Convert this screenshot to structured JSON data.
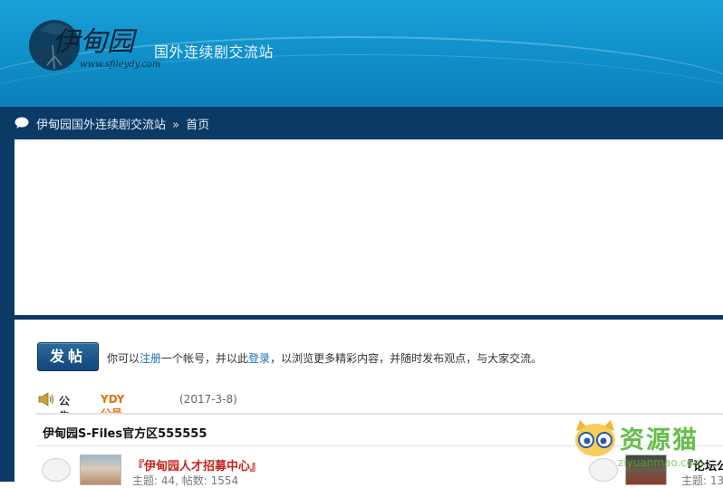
{
  "header": {
    "logo_text": "伊甸园",
    "logo_url": "www.sfileydy.com",
    "slogan": "国外连续剧交流站"
  },
  "breadcrumb": {
    "site": "伊甸园国外连续剧交流站",
    "separator": "»",
    "current": "首页"
  },
  "toolbar": {
    "post_label": "发帖"
  },
  "welcome": {
    "prefix": "你可以",
    "register_link": "注册",
    "middle": "一个帐号，并以此",
    "login_link": "登录",
    "suffix": "，以浏览更多精彩内容，并随时发布观点，与大家交流。"
  },
  "notice": {
    "label": "公告:",
    "title": "YDY公号扫码",
    "date": "(2017-3-8)"
  },
  "section": {
    "name": "伊甸园S-Files官方区555555"
  },
  "forums": [
    {
      "title": "『伊甸园人才招募中心』",
      "stats": "主题: 44, 帖数: 1554"
    },
    {
      "title": "『论坛公",
      "stats": "主题: 13"
    }
  ],
  "watermark": {
    "text": "资源猫",
    "url": "ziyuanmao.com"
  },
  "colors": {
    "header_blue": "#1aa0d8",
    "navy": "#0b3a66",
    "notice_orange": "#e0720a",
    "forum_red": "#c8231a",
    "link_blue": "#1a6fb0"
  }
}
